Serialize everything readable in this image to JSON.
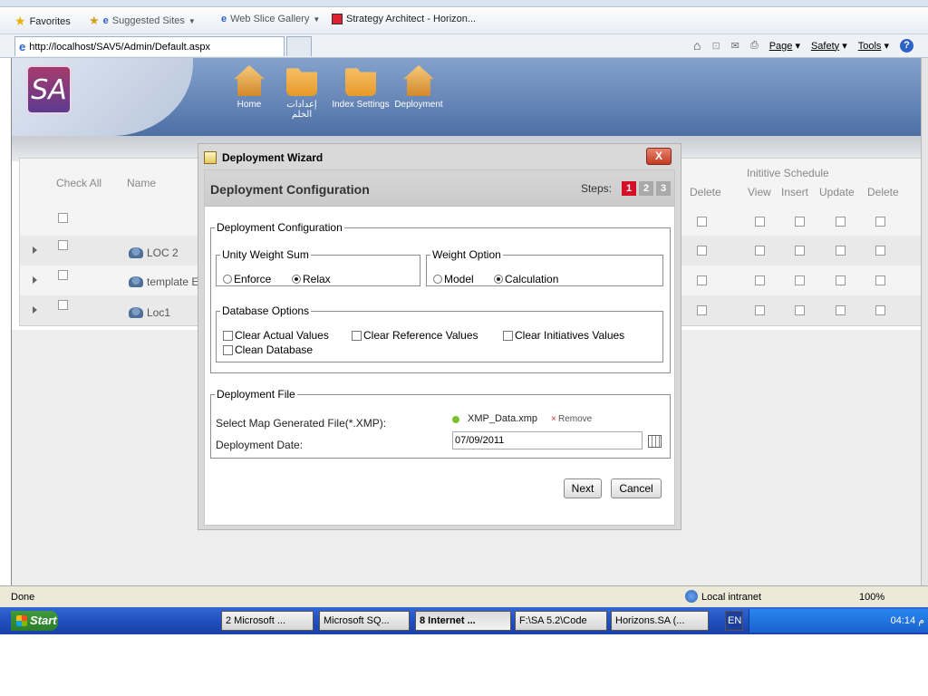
{
  "favorites": {
    "favorites_label": "Favorites",
    "suggested_sites": "Suggested Sites",
    "web_slice": "Web Slice Gallery",
    "strategy_tab": "Strategy Architect - Horizon..."
  },
  "address": {
    "url": "http://localhost/SAV5/Admin/Default.aspx"
  },
  "commands": {
    "page": "Page",
    "safety": "Safety",
    "tools": "Tools"
  },
  "app": {
    "logo_text": "SA",
    "nav": [
      {
        "label": "Home"
      },
      {
        "label": "إعدادات الخلم"
      },
      {
        "label": "Index Settings"
      },
      {
        "label": "Deployment"
      }
    ]
  },
  "grid": {
    "check_all": "Check All",
    "name": "Name",
    "delete_left": "Delete",
    "initiative_schedule": "Inititive Schedule",
    "cols": [
      "View",
      "Insert",
      "Update",
      "Delete"
    ],
    "rows": [
      {
        "name": "LOC 2"
      },
      {
        "name": "template E"
      },
      {
        "name": "Loc1"
      }
    ]
  },
  "wizard": {
    "title": "Deployment Wizard",
    "close": "X",
    "header": "Deployment Configuration",
    "steps_label": "Steps:",
    "steps": [
      "1",
      "2",
      "3"
    ],
    "config_legend": "Deployment Configuration",
    "unity_legend": "Unity Weight Sum",
    "unity_options": [
      "Enforce",
      "Relax"
    ],
    "unity_selected": "Relax",
    "weight_legend": "Weight Option",
    "weight_options": [
      "Model",
      "Calculation"
    ],
    "weight_selected": "Calculation",
    "db_legend": "Database Options",
    "db_options": [
      "Clear Actual Values",
      "Clear Reference Values",
      "Clear Initiatives Values",
      "Clean Database"
    ],
    "file_legend": "Deployment File",
    "select_file_label": "Select Map Generated File(*.XMP):",
    "file_name": "XMP_Data.xmp",
    "remove_label": "Remove",
    "date_label": "Deployment Date:",
    "date_value": "07/09/2011",
    "next": "Next",
    "cancel": "Cancel"
  },
  "status": {
    "done": "Done",
    "zone": "Local intranet",
    "zoom": "100%"
  },
  "taskbar": {
    "start": "Start",
    "items": [
      "2 Microsoft ...",
      "Microsoft SQ...",
      "8 Internet ...",
      "F:\\SA 5.2\\Code",
      "Horizons.SA (..."
    ],
    "lang": "EN",
    "clock": "04:14 م"
  }
}
